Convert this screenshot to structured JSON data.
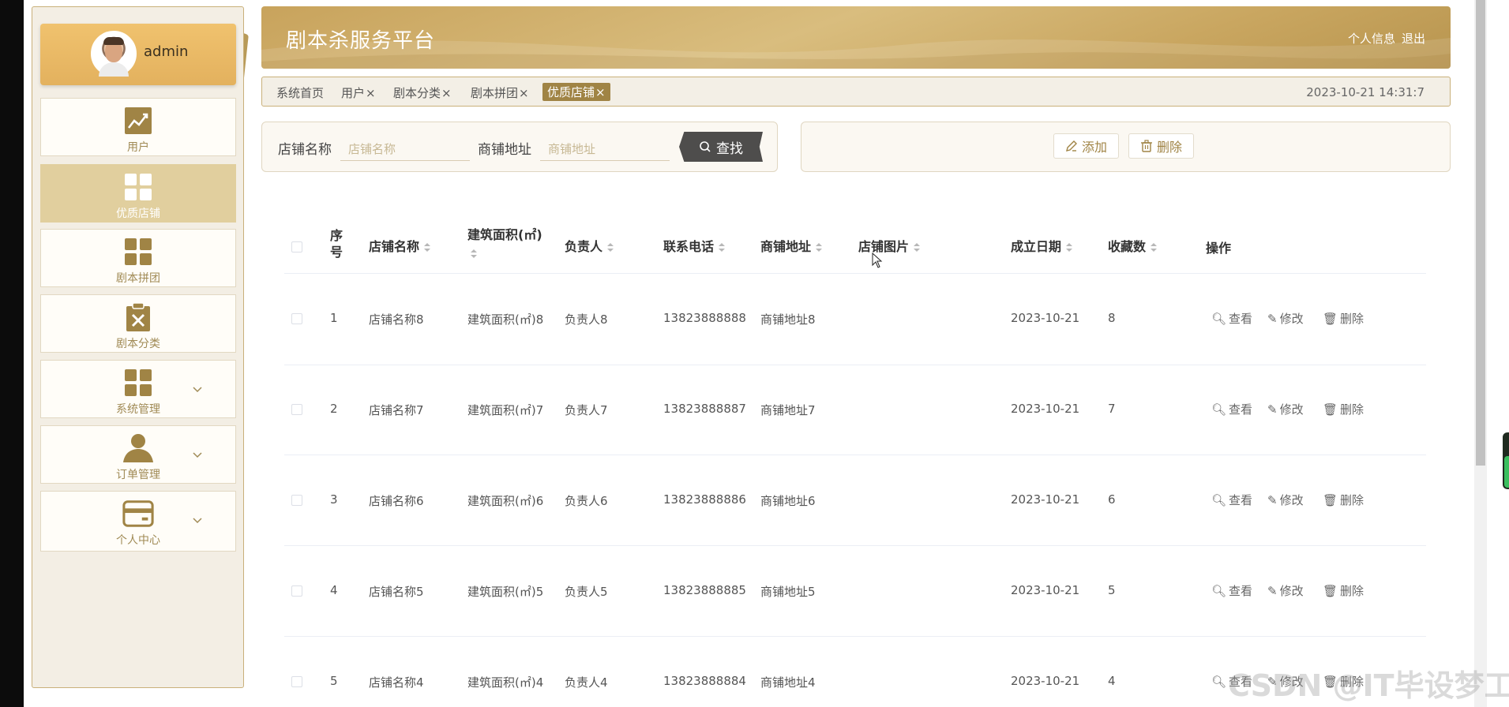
{
  "user": {
    "name": "admin"
  },
  "sidebar": {
    "items": [
      {
        "label": "用户",
        "icon": "chart-icon",
        "active": false,
        "expandable": false
      },
      {
        "label": "优质店铺",
        "icon": "grid-icon",
        "active": true,
        "expandable": false
      },
      {
        "label": "剧本拼团",
        "icon": "grid-icon",
        "active": false,
        "expandable": false
      },
      {
        "label": "剧本分类",
        "icon": "clipboard-x-icon",
        "active": false,
        "expandable": false
      },
      {
        "label": "系统管理",
        "icon": "grid-icon",
        "active": false,
        "expandable": true
      },
      {
        "label": "订单管理",
        "icon": "person-icon",
        "active": false,
        "expandable": true
      },
      {
        "label": "个人中心",
        "icon": "card-icon",
        "active": false,
        "expandable": true
      }
    ]
  },
  "header": {
    "title": "剧本杀服务平台",
    "profile_link": "个人信息",
    "logout_link": "退出"
  },
  "tabs": {
    "items": [
      {
        "label": "系统首页",
        "closable": false,
        "active": false
      },
      {
        "label": "用户",
        "closable": true,
        "active": false
      },
      {
        "label": "剧本分类",
        "closable": true,
        "active": false
      },
      {
        "label": "剧本拼团",
        "closable": true,
        "active": false
      },
      {
        "label": "优质店铺",
        "closable": true,
        "active": true
      }
    ],
    "close_glyph": "×",
    "timestamp": "2023-10-21 14:31:7"
  },
  "search": {
    "name_label": "店铺名称",
    "name_placeholder": "店铺名称",
    "address_label": "商铺地址",
    "address_placeholder": "商铺地址",
    "search_button": "查找"
  },
  "actions": {
    "add_button": "添加",
    "delete_button": "删除"
  },
  "table": {
    "headers": {
      "index": "序号",
      "shop_name": "店铺名称",
      "area": "建筑面积(㎡)",
      "manager": "负责人",
      "phone": "联系电话",
      "address": "商铺地址",
      "image": "店铺图片",
      "date": "成立日期",
      "favorites": "收藏数",
      "ops": "操作"
    },
    "ops_labels": {
      "view": "查看",
      "edit": "修改",
      "delete": "删除"
    },
    "rows": [
      {
        "index": "1",
        "shop_name": "店铺名称8",
        "area": "建筑面积(㎡)8",
        "manager": "负责人8",
        "phone": "13823888888",
        "address": "商铺地址8",
        "date": "2023-10-21",
        "favorites": "8"
      },
      {
        "index": "2",
        "shop_name": "店铺名称7",
        "area": "建筑面积(㎡)7",
        "manager": "负责人7",
        "phone": "13823888887",
        "address": "商铺地址7",
        "date": "2023-10-21",
        "favorites": "7"
      },
      {
        "index": "3",
        "shop_name": "店铺名称6",
        "area": "建筑面积(㎡)6",
        "manager": "负责人6",
        "phone": "13823888886",
        "address": "商铺地址6",
        "date": "2023-10-21",
        "favorites": "6"
      },
      {
        "index": "4",
        "shop_name": "店铺名称5",
        "area": "建筑面积(㎡)5",
        "manager": "负责人5",
        "phone": "13823888885",
        "address": "商铺地址5",
        "date": "2023-10-21",
        "favorites": "5"
      },
      {
        "index": "5",
        "shop_name": "店铺名称4",
        "area": "建筑面积(㎡)4",
        "manager": "负责人4",
        "phone": "13823888884",
        "address": "商铺地址4",
        "date": "2023-10-21",
        "favorites": "4"
      }
    ]
  },
  "watermark": "CSDN @IT毕设梦工厂",
  "colors": {
    "accent": "#c8a35c",
    "active_menu": "#e1cf9e",
    "active_tab": "#a08445",
    "search_button": "#4e4d4c"
  }
}
